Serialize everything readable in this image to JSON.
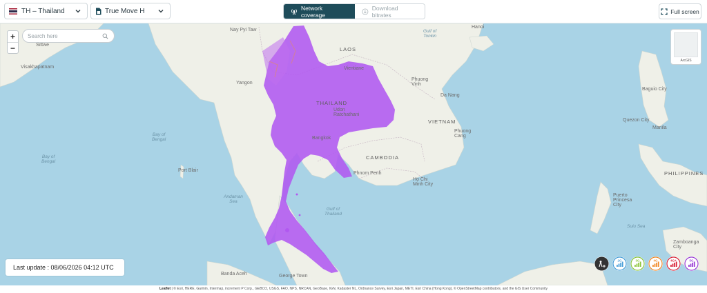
{
  "toolbar": {
    "country_label": "TH – Thailand",
    "operator_label": "True Move H",
    "network_coverage_label": "Network coverage",
    "download_bitrates_label": "Download bitrates",
    "fullscreen_label": "Full screen"
  },
  "map": {
    "search_placeholder": "Search here",
    "zoom_in": "+",
    "zoom_out": "−",
    "minimap_label": "ArcGIS",
    "coverage_color": "#b158f0",
    "water_color": "#a9d3e6",
    "land_color": "#eff0e8",
    "labels": {
      "nay_pyi_taw": "Nay Pyi Taw",
      "hanoi": "Hanoi",
      "gulf_tonkin": "Gulf of\nTonkin",
      "laos": "LAOS",
      "vientiane": "Vientiane",
      "sittwe": "Sittwe",
      "visakhapatnam": "Visakhapatnam",
      "yangon": "Yangon",
      "phuong_vinh": "Phuong\nVinh",
      "da_nang": "Da Nang",
      "thailand": "THAILAND",
      "udon": "Udon\nRatchathani",
      "vietnam": "VIETNAM",
      "bay_bengal_1": "Bay of\nBengal",
      "bay_bengal_2": "Bay of\nBengal",
      "bangkok": "Bangkok",
      "phuong_cang": "Phuong\nCang",
      "cambodia": "CAMBODIA",
      "phnom_penh": "Phnom Penh",
      "ho_chi_minh": "Ho Chi\nMinh City",
      "port_blair": "Port Blair",
      "andaman": "Andaman\nSea",
      "gulf_thailand": "Gulf of\nThailand",
      "banda_aceh": "Banda Aceh",
      "george_town": "George Town",
      "baguio": "Baguio City",
      "quezon": "Quezon City",
      "manila": "Manila",
      "philippines": "PHILIPPINES",
      "puerto": "Puerto\nPrincesa\nCity",
      "sulu": "Sulu Sea",
      "zamboanga": "Zamboanga\nCity"
    }
  },
  "last_update": "Last update : 08/06/2026 04:12 UTC",
  "technologies": [
    {
      "name": "all",
      "color": "#333333"
    },
    {
      "name": "2G",
      "color": "#4a9fd8"
    },
    {
      "name": "3G",
      "color": "#8dc63f"
    },
    {
      "name": "4G",
      "color": "#f08a2a"
    },
    {
      "name": "4G+",
      "color": "#d9263a"
    },
    {
      "name": "5G",
      "color": "#9b3fd6"
    }
  ],
  "attribution": {
    "leaflet": "Leaflet",
    "text": "| © Esri, HERE, Garmin, Intermap, increment P Corp., GEBCO, USGS, FAO, NPS, NRCAN, GeoBase, IGN, Kadaster NL, Ordnance Survey, Esri Japan, METI, Esri China (Hong Kong), © OpenStreetMap contributors, and the GIS User Community"
  }
}
